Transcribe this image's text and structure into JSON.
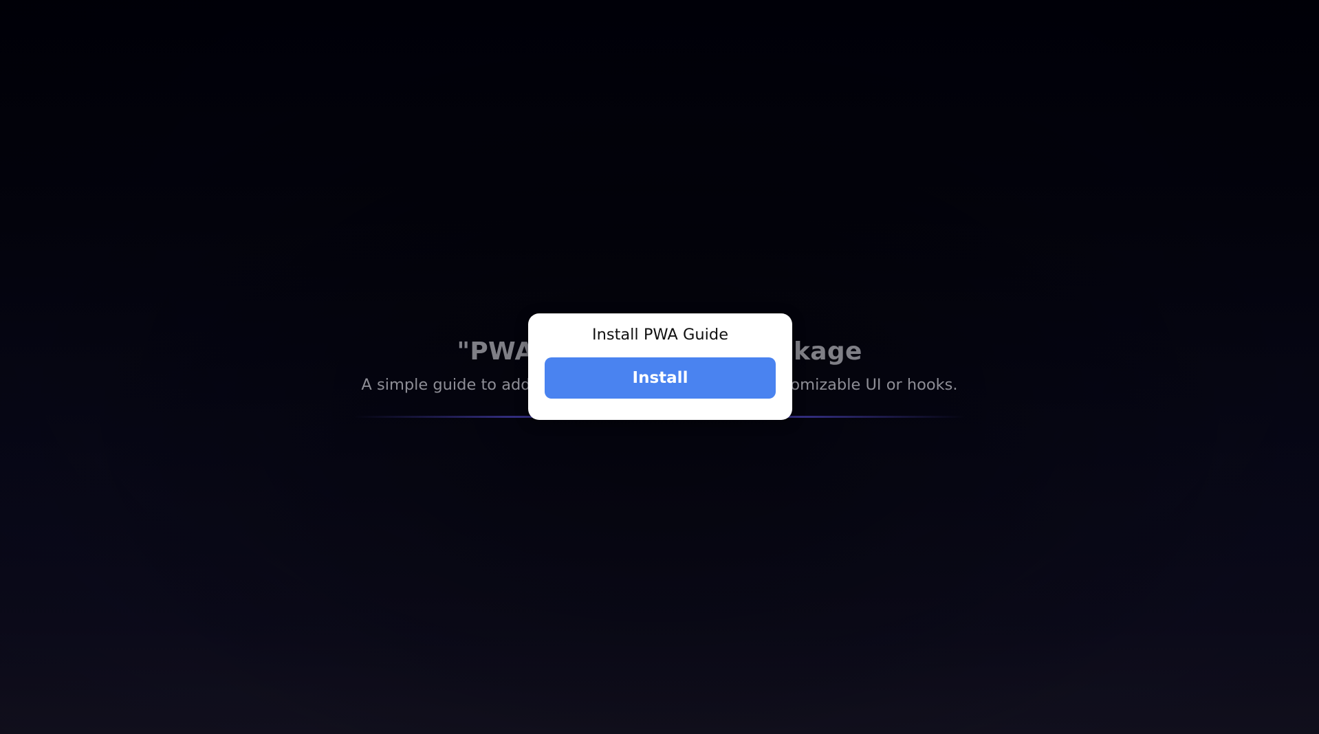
{
  "hero": {
    "title": "\"PWA Install Guide\" Package",
    "subtitle": "A simple guide to add PWA install to your app with customizable UI or hooks."
  },
  "dialog": {
    "title": "Install PWA Guide",
    "install_label": "Install"
  },
  "colors": {
    "accent": "#4a83f0",
    "background": "#03030d",
    "divider": "#3c3696"
  }
}
